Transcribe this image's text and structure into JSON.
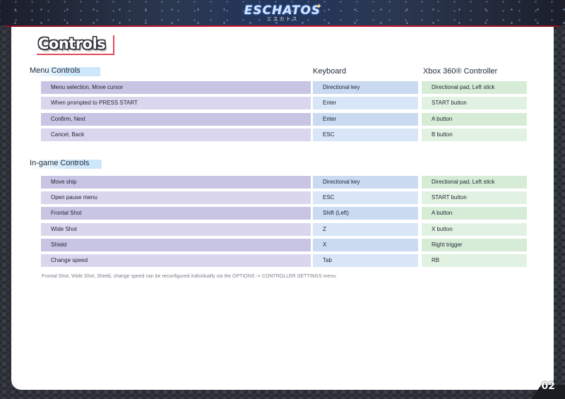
{
  "header": {
    "logo_text": "ESCHATOS",
    "logo_sub": "エスカトス"
  },
  "page": {
    "title": "Controls",
    "page_number": "02"
  },
  "columns": {
    "keyboard": "Keyboard",
    "controller": "Xbox 360® Controller"
  },
  "menu_controls": {
    "heading": "Menu Controls",
    "rows": [
      {
        "action": "Menu selection, Move cursor",
        "keyboard": "Directional key",
        "controller": "Directional pad, Left stick"
      },
      {
        "action": "When prompted to PRESS START",
        "keyboard": "Enter",
        "controller": "START button"
      },
      {
        "action": "Confirm, Next",
        "keyboard": "Enter",
        "controller": "A button"
      },
      {
        "action": "Cancel, Back",
        "keyboard": "ESC",
        "controller": "B button"
      }
    ]
  },
  "ingame_controls": {
    "heading": "In-game Controls",
    "rows": [
      {
        "action": "Move ship",
        "keyboard": "Directional key",
        "controller": "Directional pad, Left stick"
      },
      {
        "action": "Open pause menu",
        "keyboard": "ESC",
        "controller": "START button"
      },
      {
        "action": "Frontal Shot",
        "keyboard": "Shift (Left)",
        "controller": "A button"
      },
      {
        "action": "Wide Shot",
        "keyboard": "Z",
        "controller": "X button"
      },
      {
        "action": "Shield",
        "keyboard": "X",
        "controller": "Right trigger"
      },
      {
        "action": "Change speed",
        "keyboard": "Tab",
        "controller": "RB"
      }
    ]
  },
  "footnote": "Frontal Shot, Wide Shot, Shield, change speed can be reconfigured individually via the OPTIONS -> CONTROLLER SETTINGS menu.",
  "colors": {
    "accent_red": "#d11a33",
    "action_col": "#c7c4e4",
    "keyboard_col": "#c9daf1",
    "controller_col": "#d6ecd6"
  }
}
